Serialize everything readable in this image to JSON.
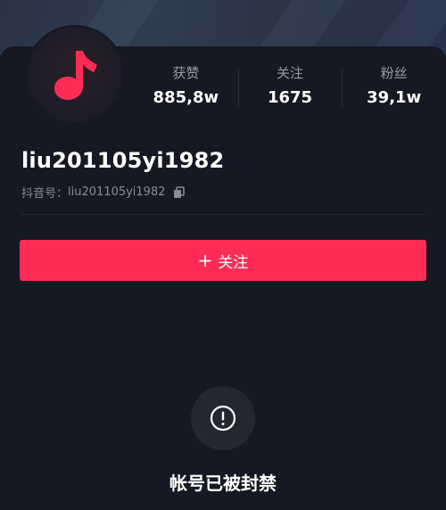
{
  "profile": {
    "username": "liu201105yi1982",
    "id_label": "抖音号：",
    "id_value": "liu201105yi1982"
  },
  "stats": [
    {
      "label": "获赞",
      "value": "885,8w"
    },
    {
      "label": "关注",
      "value": "1675"
    },
    {
      "label": "粉丝",
      "value": "39,1w"
    }
  ],
  "follow_button": {
    "plus": "+",
    "label": "关注"
  },
  "status": {
    "banned_text": "帐号已被封禁"
  },
  "colors": {
    "accent": "#fe2c55",
    "background": "#161823"
  },
  "icons": {
    "avatar": "music-note-icon",
    "copy": "copy-icon",
    "warning": "exclamation-circle-icon"
  }
}
